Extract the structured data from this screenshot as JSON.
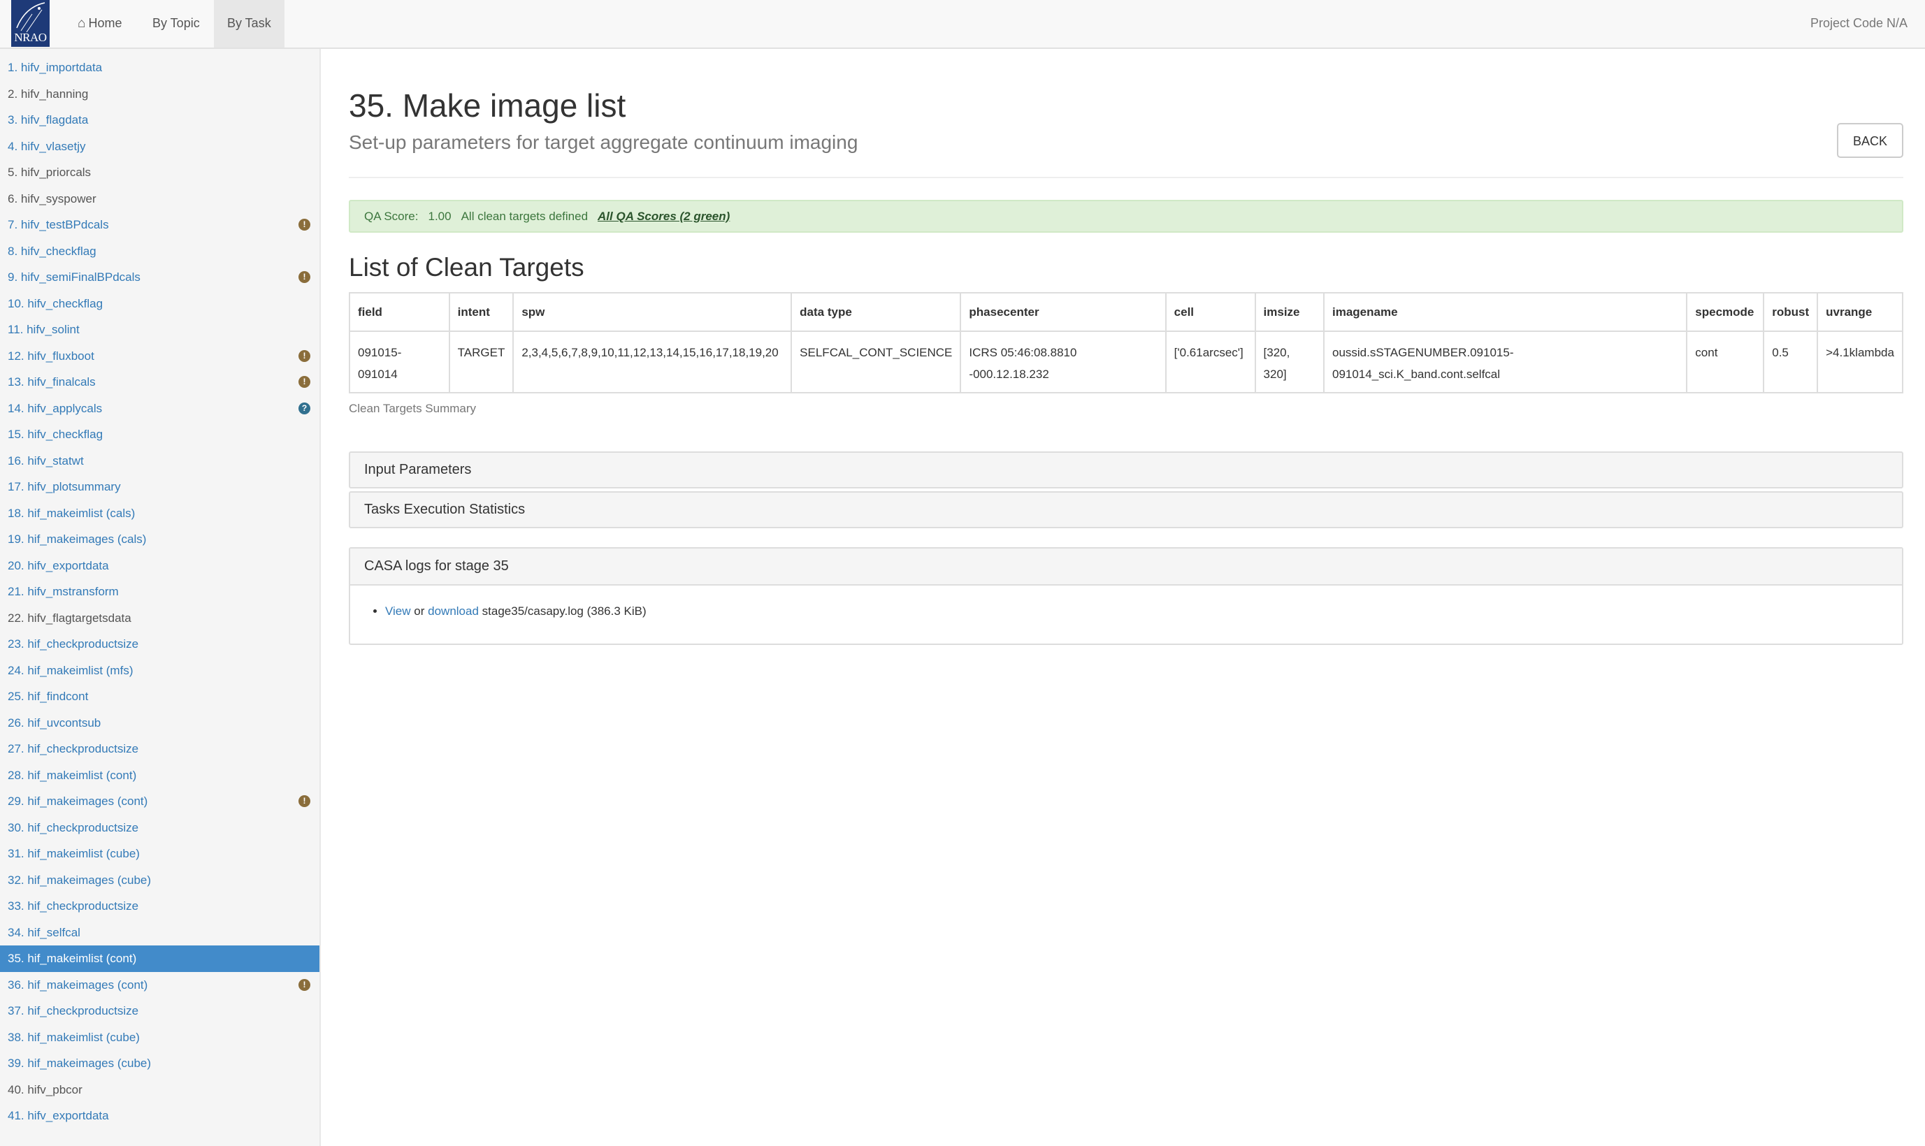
{
  "navbar": {
    "logo_text": "NRAO",
    "home_label": "Home",
    "by_topic_label": "By Topic",
    "by_task_label": "By Task",
    "project_code": "Project Code N/A"
  },
  "sidebar": {
    "items": [
      {
        "label": "1. hifv_importdata",
        "style": "link",
        "badge": ""
      },
      {
        "label": "2. hifv_hanning",
        "style": "plain",
        "badge": ""
      },
      {
        "label": "3. hifv_flagdata",
        "style": "link",
        "badge": ""
      },
      {
        "label": "4. hifv_vlasetjy",
        "style": "link",
        "badge": ""
      },
      {
        "label": "5. hifv_priorcals",
        "style": "plain",
        "badge": ""
      },
      {
        "label": "6. hifv_syspower",
        "style": "plain",
        "badge": ""
      },
      {
        "label": "7. hifv_testBPdcals",
        "style": "link",
        "badge": "warning"
      },
      {
        "label": "8. hifv_checkflag",
        "style": "link",
        "badge": ""
      },
      {
        "label": "9. hifv_semiFinalBPdcals",
        "style": "link",
        "badge": "warning"
      },
      {
        "label": "10. hifv_checkflag",
        "style": "link",
        "badge": ""
      },
      {
        "label": "11. hifv_solint",
        "style": "link",
        "badge": ""
      },
      {
        "label": "12. hifv_fluxboot",
        "style": "link",
        "badge": "warning"
      },
      {
        "label": "13. hifv_finalcals",
        "style": "link",
        "badge": "warning"
      },
      {
        "label": "14. hifv_applycals",
        "style": "link",
        "badge": "info"
      },
      {
        "label": "15. hifv_checkflag",
        "style": "link",
        "badge": ""
      },
      {
        "label": "16. hifv_statwt",
        "style": "link",
        "badge": ""
      },
      {
        "label": "17. hifv_plotsummary",
        "style": "link",
        "badge": ""
      },
      {
        "label": "18. hif_makeimlist (cals)",
        "style": "link",
        "badge": ""
      },
      {
        "label": "19. hif_makeimages (cals)",
        "style": "link",
        "badge": ""
      },
      {
        "label": "20. hifv_exportdata",
        "style": "link",
        "badge": ""
      },
      {
        "label": "21. hifv_mstransform",
        "style": "link",
        "badge": ""
      },
      {
        "label": "22. hifv_flagtargetsdata",
        "style": "plain",
        "badge": ""
      },
      {
        "label": "23. hif_checkproductsize",
        "style": "link",
        "badge": ""
      },
      {
        "label": "24. hif_makeimlist (mfs)",
        "style": "link",
        "badge": ""
      },
      {
        "label": "25. hif_findcont",
        "style": "link",
        "badge": ""
      },
      {
        "label": "26. hif_uvcontsub",
        "style": "link",
        "badge": ""
      },
      {
        "label": "27. hif_checkproductsize",
        "style": "link",
        "badge": ""
      },
      {
        "label": "28. hif_makeimlist (cont)",
        "style": "link",
        "badge": ""
      },
      {
        "label": "29. hif_makeimages (cont)",
        "style": "link",
        "badge": "warning"
      },
      {
        "label": "30. hif_checkproductsize",
        "style": "link",
        "badge": ""
      },
      {
        "label": "31. hif_makeimlist (cube)",
        "style": "link",
        "badge": ""
      },
      {
        "label": "32. hif_makeimages (cube)",
        "style": "link",
        "badge": ""
      },
      {
        "label": "33. hif_checkproductsize",
        "style": "link",
        "badge": ""
      },
      {
        "label": "34. hif_selfcal",
        "style": "link",
        "badge": ""
      },
      {
        "label": "35. hif_makeimlist (cont)",
        "style": "selected",
        "badge": ""
      },
      {
        "label": "36. hif_makeimages (cont)",
        "style": "link",
        "badge": "warning"
      },
      {
        "label": "37. hif_checkproductsize",
        "style": "link",
        "badge": ""
      },
      {
        "label": "38. hif_makeimlist (cube)",
        "style": "link",
        "badge": ""
      },
      {
        "label": "39. hif_makeimages (cube)",
        "style": "link",
        "badge": ""
      },
      {
        "label": "40. hifv_pbcor",
        "style": "plain",
        "badge": ""
      },
      {
        "label": "41. hifv_exportdata",
        "style": "link",
        "badge": ""
      }
    ]
  },
  "main": {
    "title": "35. Make image list",
    "subtitle": "Set-up parameters for target aggregate continuum imaging",
    "back_label": "BACK",
    "qa": {
      "score_label": "QA Score:",
      "score_value": "1.00",
      "message": "All clean targets defined",
      "all_scores_link": "All QA Scores (2 green)"
    },
    "section_title": "List of Clean Targets",
    "table": {
      "headers": [
        "field",
        "intent",
        "spw",
        "data type",
        "phasecenter",
        "cell",
        "imsize",
        "imagename",
        "specmode",
        "robust",
        "uvrange"
      ],
      "row": [
        "091015-091014",
        "TARGET",
        "2,3,4,5,6,7,8,9,10,11,12,13,14,15,16,17,18,19,20",
        "SELFCAL_CONT_SCIENCE",
        "ICRS 05:46:08.8810 -000.12.18.232",
        "['0.61arcsec']",
        "[320, 320]",
        "oussid.sSTAGENUMBER.091015-091014_sci.K_band.cont.selfcal",
        "cont",
        "0.5",
        ">4.1klambda"
      ]
    },
    "caption": "Clean Targets Summary",
    "input_parameters_label": "Input Parameters",
    "tasks_stats_label": "Tasks Execution Statistics",
    "casa": {
      "heading": "CASA logs for stage 35",
      "view_label": "View",
      "or_text": "or",
      "download_label": "download",
      "file_text": "stage35/casapy.log (386.3 KiB)"
    }
  },
  "colors": {
    "link": "#337ab7",
    "selected_bg": "#428bca",
    "qa_green_bg": "#dff0d8",
    "warning_badge": "#8a6d3b",
    "info_badge": "#31708f"
  }
}
